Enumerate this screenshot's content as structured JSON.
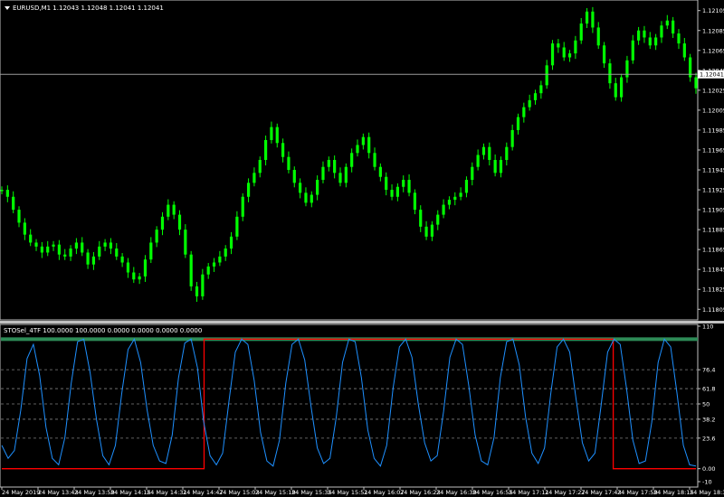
{
  "main_header": "EURUSD,M1  1.12043 1.12048 1.12041 1.12041",
  "indicator_header": "STOSel_4TF 100.0000 100.0000 0.0000 0.0000 0.0000 0.0000",
  "current_price_label": "1.12041",
  "colors": {
    "background": "#000000",
    "candle": "#00ff00",
    "grid": "#c0c0c0",
    "stoch_line": "#1e90ff",
    "state_line": "#ff0000",
    "top_band": "#2e8b57"
  },
  "chart_data": [
    {
      "type": "line",
      "title": "EURUSD,M1",
      "ylim": [
        1.11798,
        1.12112
      ],
      "y_ticks": [
        "1.12105",
        "1.12085",
        "1.12065",
        "1.12045",
        "1.12025",
        "1.12005",
        "1.11985",
        "1.11965",
        "1.11945",
        "1.11925",
        "1.11905",
        "1.11885",
        "1.11865",
        "1.11845",
        "1.11825",
        "1.11805"
      ],
      "current_price": 1.12041,
      "series": [
        {
          "values": [
            1.11925,
            1.11918,
            1.11905,
            1.11892,
            1.1188,
            1.11872,
            1.11868,
            1.11862,
            1.11868,
            1.1187,
            1.1186,
            1.11858,
            1.11866,
            1.11872,
            1.11862,
            1.1185,
            1.11858,
            1.11868,
            1.11872,
            1.11866,
            1.11858,
            1.11852,
            1.11842,
            1.11835,
            1.11838,
            1.11855,
            1.11872,
            1.11885,
            1.11898,
            1.1191,
            1.119,
            1.11885,
            1.1186,
            1.11828,
            1.11818,
            1.1184,
            1.11848,
            1.11852,
            1.11858,
            1.11866,
            1.11878,
            1.11898,
            1.11918,
            1.11932,
            1.11942,
            1.11955,
            1.11975,
            1.11988,
            1.11972,
            1.11958,
            1.11945,
            1.11932,
            1.11922,
            1.11912,
            1.1192,
            1.11935,
            1.11948,
            1.11955,
            1.11942,
            1.11932,
            1.11948,
            1.11962,
            1.1197,
            1.11978,
            1.11962,
            1.11948,
            1.11938,
            1.11925,
            1.11918,
            1.11928,
            1.11935,
            1.11922,
            1.11905,
            1.11888,
            1.11878,
            1.1189,
            1.119,
            1.1191,
            1.11915,
            1.11918,
            1.11922,
            1.11935,
            1.11948,
            1.1196,
            1.11968,
            1.11955,
            1.11942,
            1.11955,
            1.11968,
            1.11985,
            1.11998,
            1.12008,
            1.12015,
            1.12022,
            1.1203,
            1.1205,
            1.12072,
            1.12068,
            1.12058,
            1.12062,
            1.12075,
            1.12092,
            1.12104,
            1.12088,
            1.1207,
            1.12052,
            1.12032,
            1.12018,
            1.12038,
            1.12055,
            1.12075,
            1.12085,
            1.12078,
            1.1207,
            1.12078,
            1.1209,
            1.12095,
            1.12082,
            1.12072,
            1.12058,
            1.12038,
            1.12027
          ]
        }
      ]
    },
    {
      "type": "line",
      "title": "STOSel_4TF",
      "ylim": [
        -10,
        110
      ],
      "y_ticks": [
        "110",
        "76.4",
        "61.8",
        "50",
        "38.2",
        "23.6",
        "0.00",
        "-10"
      ],
      "levels": [
        76.4,
        61.8,
        50,
        38.2,
        23.6
      ],
      "x_ticks": [
        "24 May 2019",
        "24 May 13:43",
        "24 May 13:59",
        "24 May 14:15",
        "24 May 14:31",
        "24 May 14:47",
        "24 May 15:03",
        "24 May 15:19",
        "24 May 15:35",
        "24 May 15:51",
        "24 May 16:07",
        "24 May 16:23",
        "24 May 16:39",
        "24 May 16:55",
        "24 May 17:11",
        "24 May 17:27",
        "24 May 17:43",
        "24 May 17:59",
        "24 May 18:15",
        "24 May 18:31"
      ],
      "top_band_value": 100,
      "series": [
        {
          "values": [
            18,
            8,
            14,
            45,
            85,
            96,
            72,
            32,
            8,
            3,
            24,
            66,
            98,
            100,
            74,
            38,
            10,
            3,
            18,
            58,
            92,
            100,
            82,
            46,
            18,
            6,
            4,
            26,
            70,
            97,
            100,
            78,
            36,
            10,
            3,
            12,
            52,
            90,
            100,
            96,
            68,
            28,
            6,
            2,
            22,
            66,
            96,
            100,
            84,
            48,
            16,
            4,
            8,
            40,
            82,
            100,
            98,
            70,
            30,
            8,
            2,
            18,
            62,
            94,
            100,
            86,
            50,
            20,
            6,
            10,
            44,
            86,
            100,
            96,
            64,
            26,
            6,
            3,
            24,
            70,
            98,
            100,
            80,
            40,
            12,
            4,
            16,
            58,
            94,
            100,
            90,
            54,
            20,
            6,
            12,
            50,
            90,
            100,
            96,
            62,
            22,
            4,
            6,
            36,
            82,
            100,
            94,
            58,
            18,
            3,
            2
          ]
        },
        {
          "values": [
            0,
            0,
            0,
            0,
            0,
            0,
            0,
            0,
            0,
            0,
            0,
            0,
            0,
            0,
            0,
            0,
            0,
            0,
            0,
            0,
            0,
            0,
            0,
            0,
            0,
            0,
            0,
            0,
            0,
            0,
            0,
            0,
            0,
            0,
            0,
            0,
            0,
            0,
            0,
            0,
            0,
            0,
            0,
            0,
            100,
            100,
            100,
            100,
            100,
            100,
            100,
            100,
            100,
            100,
            100,
            100,
            100,
            100,
            100,
            100,
            100,
            100,
            100,
            100,
            100,
            100,
            100,
            100,
            100,
            100,
            100,
            100,
            100,
            100,
            100,
            100,
            100,
            100,
            100,
            100,
            100,
            100,
            100,
            100,
            100,
            100,
            100,
            100,
            100,
            100,
            100,
            100,
            100,
            100,
            100,
            100,
            100,
            100,
            100,
            100,
            100,
            100,
            100,
            100,
            100,
            100,
            100,
            100,
            100,
            100,
            100,
            100,
            100,
            100,
            100,
            100,
            100,
            100,
            100,
            100,
            100,
            100,
            100,
            100,
            100,
            100,
            100,
            100,
            100,
            100,
            100,
            100,
            100,
            0,
            0,
            0,
            0,
            0,
            0,
            0,
            0,
            0,
            0,
            0,
            0,
            0,
            0,
            0,
            0,
            0,
            0,
            0
          ]
        }
      ]
    }
  ]
}
